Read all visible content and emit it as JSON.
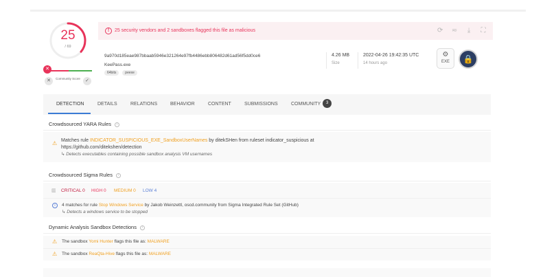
{
  "score": {
    "value": "25",
    "total": "/ 69"
  },
  "community": {
    "label": "Community Score",
    "x_glyph": "✕",
    "down_glyph": "✕",
    "up_glyph": "✓"
  },
  "alert": {
    "icon": "!",
    "text": "25 security vendors and 2 sandboxes flagged this file as malicious",
    "actions": [
      "reanalyze-icon",
      "similar-icon",
      "download-icon",
      "graph-icon"
    ]
  },
  "file": {
    "hash": "9a970d185eae987bbaab5946e321264e97fb4486ebb806482d61ad56f5dd0ce6",
    "name": "KeePass.exe",
    "tags": [
      "64bits",
      "peexe"
    ],
    "size_value": "4.26 MB",
    "size_label": "Size",
    "date_value": "2022-04-26 19:42:35 UTC",
    "date_label": "14 hours ago",
    "type_label": "EXE"
  },
  "tabs": [
    {
      "label": "DETECTION"
    },
    {
      "label": "DETAILS"
    },
    {
      "label": "RELATIONS"
    },
    {
      "label": "BEHAVIOR"
    },
    {
      "label": "CONTENT"
    },
    {
      "label": "SUBMISSIONS"
    },
    {
      "label": "COMMUNITY",
      "badge": "3"
    }
  ],
  "yara": {
    "title": "Crowdsourced YARA Rules",
    "prefix": "Matches rule ",
    "rule": "INDICATOR_SUSPICIOUS_EXE_SandboxUserNames",
    "middle": " by ditekSHen from ruleset indicator_suspicious at",
    "url": "https://github.com/ditekshen/detection",
    "desc": "Detects executables containing possible sandbox analysis VM usernames"
  },
  "sigma": {
    "title": "Crowdsourced Sigma Rules",
    "critical": "CRITICAL 0",
    "high": "HIGH 0",
    "medium": "MEDIUM 0",
    "low": "LOW 4",
    "prefix": "4 matches for rule ",
    "rule": "Stop Windows Service",
    "suffix": " by Jakob Weinzettl, oscd.community from Sigma Integrated Rule Set (GitHub)",
    "desc": "Detects a windows service to be stopped"
  },
  "sandbox": {
    "title": "Dynamic Analysis Sandbox Detections",
    "rows": [
      {
        "prefix": "The sandbox ",
        "name": "Yomi Hunter",
        "middle": " flags this file as: ",
        "verdict": "MALWARE"
      },
      {
        "prefix": "The sandbox ",
        "name": "ReaQta-Hive",
        "middle": " flags this file as: ",
        "verdict": "MALWARE"
      }
    ]
  },
  "colors": {
    "malicious": "#e8335a",
    "link": "#f0a020",
    "accent": "#3a7bd5",
    "critical": "#c0183c",
    "high": "#e8335a",
    "medium": "#f0a020",
    "low": "#5a7fd6"
  }
}
